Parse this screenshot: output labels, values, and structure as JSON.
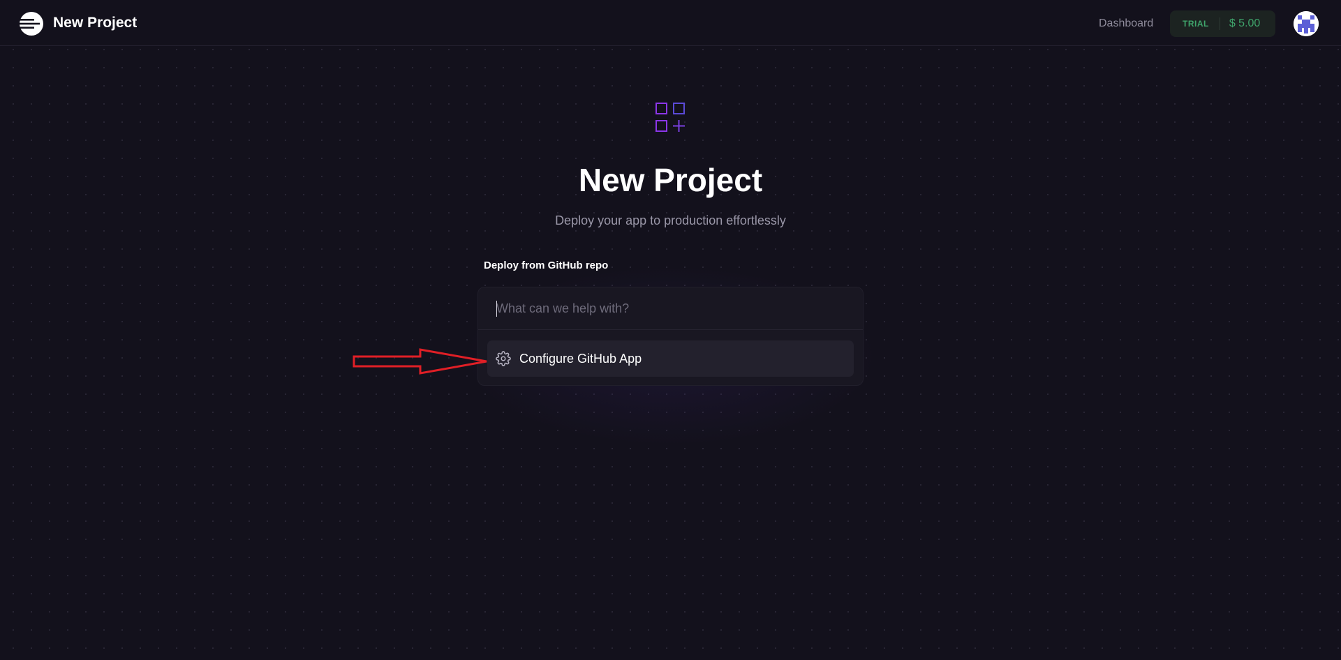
{
  "header": {
    "title": "New Project",
    "logo_icon": "railway-logo-icon",
    "nav": {
      "dashboard_label": "Dashboard"
    },
    "plan": {
      "label": "TRIAL",
      "amount": "$ 5.00"
    },
    "avatar_icon": "user-avatar-icon"
  },
  "main": {
    "hero_icon": "grid-add-icon",
    "title": "New Project",
    "subtitle": "Deploy your app to production effortlessly",
    "section_label": "Deploy from GitHub repo",
    "search": {
      "placeholder": "What can we help with?",
      "value": ""
    },
    "options": [
      {
        "label": "Configure GitHub App",
        "icon": "gear-icon"
      }
    ]
  },
  "annotation": {
    "type": "red-arrow-pointer",
    "color": "#e01f26"
  },
  "colors": {
    "background": "#13111c",
    "accent": "#8b36e8",
    "trial_green": "#3fa46b",
    "card": "#191722"
  }
}
